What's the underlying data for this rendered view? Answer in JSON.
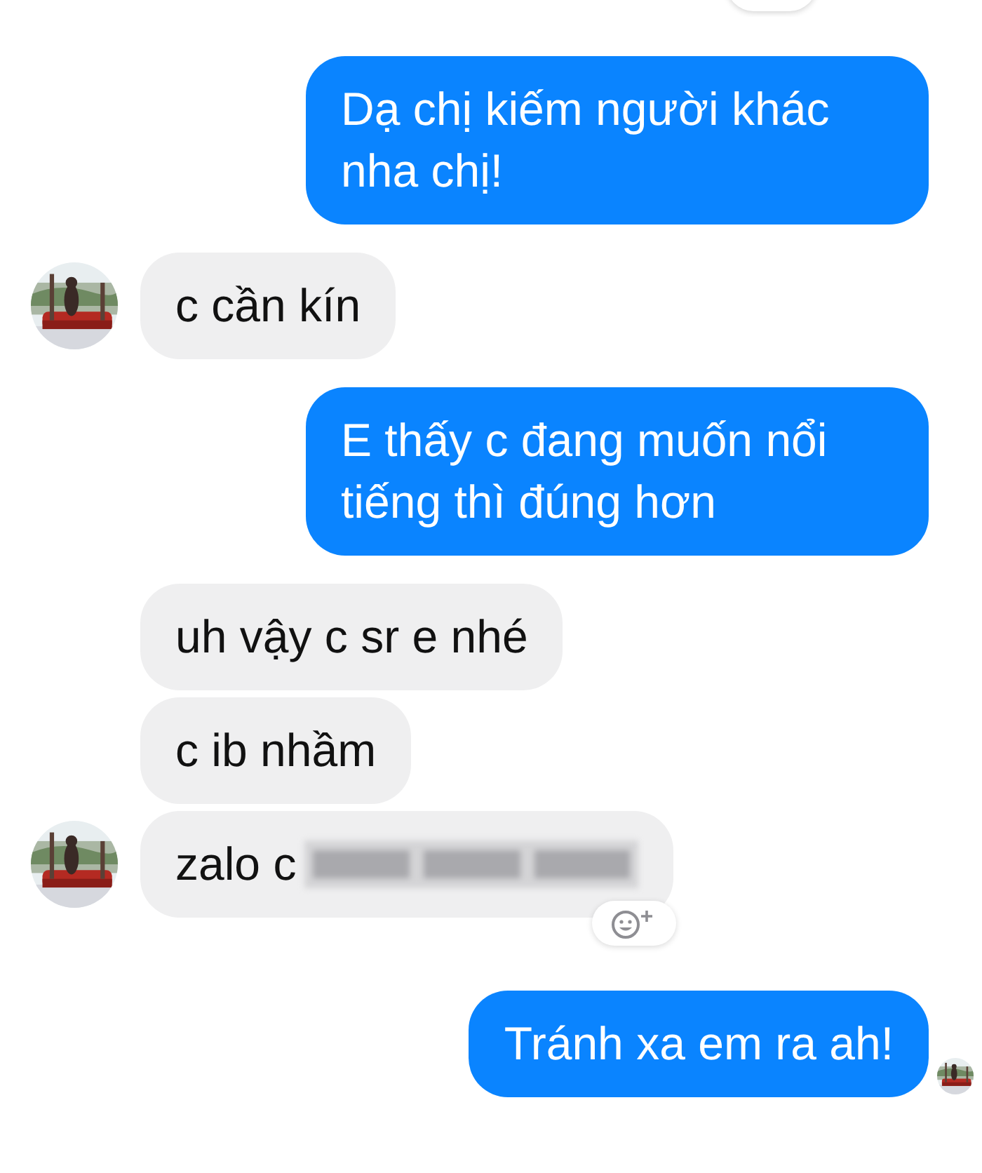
{
  "top_reaction_button": {
    "shown": true
  },
  "messages": [
    {
      "kind": "sent",
      "text": "Dạ chị kiếm người khác nha chị!",
      "seen": false
    },
    {
      "kind": "received",
      "text": "c cần kín",
      "avatar": true,
      "redacted": false,
      "reaction": false
    },
    {
      "kind": "sent",
      "text": "E thấy c đang muốn nổi tiếng thì đúng hơn",
      "seen": false
    },
    {
      "kind": "received",
      "text": "uh vậy c sr e nhé",
      "avatar": false,
      "redacted": false,
      "reaction": false
    },
    {
      "kind": "received",
      "text": "c ib nhầm",
      "avatar": false,
      "redacted": false,
      "reaction": false
    },
    {
      "kind": "received",
      "text": "zalo c",
      "avatar": true,
      "redacted": true,
      "reaction": true
    },
    {
      "kind": "sent",
      "text": "Tránh xa em ra ah!",
      "seen": true
    }
  ]
}
